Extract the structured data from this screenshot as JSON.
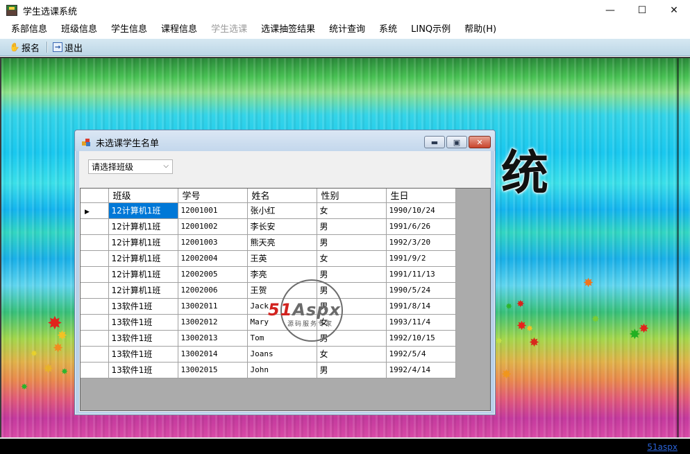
{
  "window": {
    "title": "学生选课系统",
    "controls": {
      "minimize": "—",
      "maximize": "☐",
      "close": "✕"
    }
  },
  "menu": [
    {
      "label": "系部信息",
      "disabled": false
    },
    {
      "label": "班级信息",
      "disabled": false
    },
    {
      "label": "学生信息",
      "disabled": false
    },
    {
      "label": "课程信息",
      "disabled": false
    },
    {
      "label": "学生选课",
      "disabled": true
    },
    {
      "label": "选课抽签结果",
      "disabled": false
    },
    {
      "label": "统计查询",
      "disabled": false
    },
    {
      "label": "系统",
      "disabled": false
    },
    {
      "label": "LINQ示例",
      "disabled": false
    },
    {
      "label": "帮助(H)",
      "disabled": false
    }
  ],
  "toolbar": {
    "register_label": "报名",
    "exit_label": "退出",
    "register_icon": "hand-icon",
    "exit_icon": "exit-icon"
  },
  "background": {
    "banner_char": "统",
    "status_link": "51aspx"
  },
  "child_window": {
    "title": "未选课学生名单",
    "class_select": {
      "value": "请选择班级"
    },
    "columns": [
      "班级",
      "学号",
      "姓名",
      "性别",
      "生日"
    ],
    "rows": [
      [
        "12计算机1班",
        "12001001",
        "张小红",
        "女",
        "1990/10/24"
      ],
      [
        "12计算机1班",
        "12001002",
        "李长安",
        "男",
        "1991/6/26"
      ],
      [
        "12计算机1班",
        "12001003",
        "熊天亮",
        "男",
        "1992/3/20"
      ],
      [
        "12计算机1班",
        "12002004",
        "王英",
        "女",
        "1991/9/2"
      ],
      [
        "12计算机1班",
        "12002005",
        "李亮",
        "男",
        "1991/11/13"
      ],
      [
        "12计算机1班",
        "12002006",
        "王贺",
        "男",
        "1990/5/24"
      ],
      [
        "13软件1班",
        "13002011",
        "Jack",
        "男",
        "1991/8/14"
      ],
      [
        "13软件1班",
        "13002012",
        "Mary",
        "女",
        "1993/11/4"
      ],
      [
        "13软件1班",
        "13002013",
        "Tom",
        "男",
        "1992/10/15"
      ],
      [
        "13软件1班",
        "13002014",
        "Joans",
        "女",
        "1992/5/4"
      ],
      [
        "13软件1班",
        "13002015",
        "John",
        "男",
        "1992/4/14"
      ]
    ]
  },
  "watermark": {
    "brand_red": "51",
    "brand_grey": "Aspx",
    "tagline": "源码服务专家"
  }
}
